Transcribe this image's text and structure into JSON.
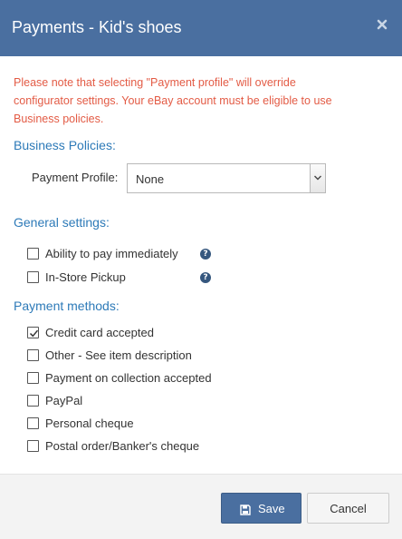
{
  "dialog": {
    "title": "Payments - Kid's shoes",
    "close_icon": "close-icon"
  },
  "warning": {
    "line1": "Please note that selecting \"Payment profile\" will override",
    "line2": "configurator settings. Your eBay account must be eligible to use",
    "line3": "Business policies."
  },
  "business_policies": {
    "heading": "Business Policies:",
    "payment_profile_label": "Payment Profile:",
    "payment_profile_value": "None"
  },
  "general_settings": {
    "heading": "General settings:",
    "options": [
      {
        "label": "Ability to pay immediately",
        "checked": false,
        "help": "?"
      },
      {
        "label": "In-Store Pickup",
        "checked": false,
        "help": "?"
      }
    ]
  },
  "payment_methods": {
    "heading": "Payment methods:",
    "options": [
      {
        "label": "Credit card accepted",
        "checked": true
      },
      {
        "label": "Other - See item description",
        "checked": false
      },
      {
        "label": "Payment on collection accepted",
        "checked": false
      },
      {
        "label": "PayPal",
        "checked": false
      },
      {
        "label": "Personal cheque",
        "checked": false
      },
      {
        "label": "Postal order/Banker's cheque",
        "checked": false
      }
    ]
  },
  "footer": {
    "save_label": "Save",
    "cancel_label": "Cancel"
  },
  "colors": {
    "header_bg": "#4a6fa0",
    "warning_text": "#e35b45",
    "section_heading": "#2d7ab8",
    "help_icon": "#35577e"
  }
}
